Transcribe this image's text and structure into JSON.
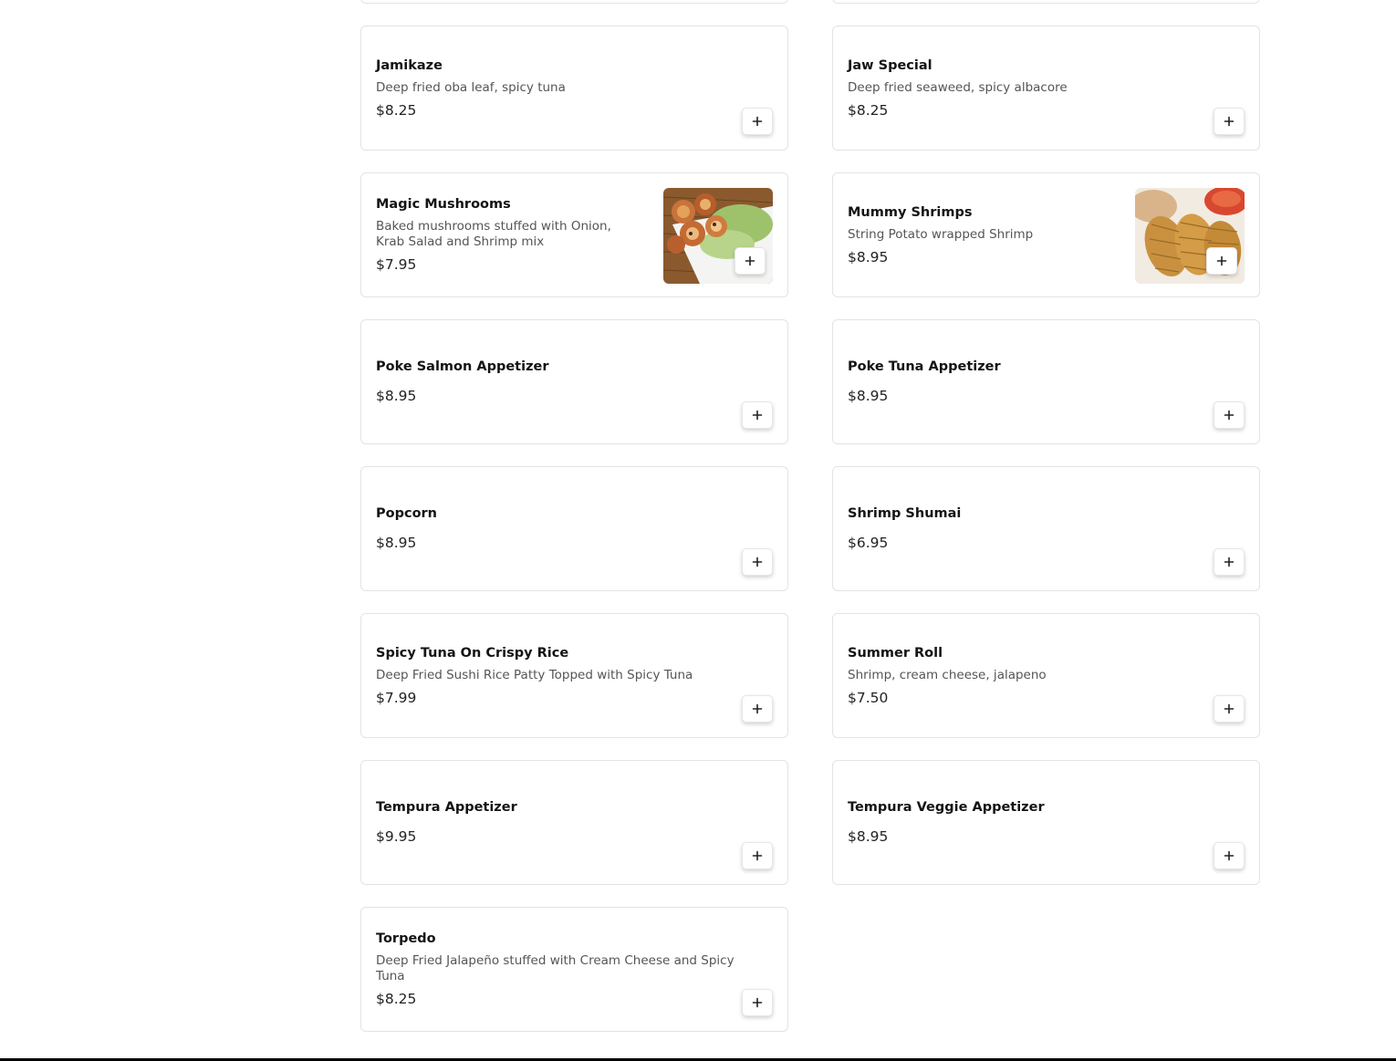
{
  "items": [
    {
      "name": "Jamikaze",
      "desc": "Deep fried oba leaf, spicy tuna",
      "price": "$8.25"
    },
    {
      "name": "Jaw Special",
      "desc": "Deep fried seaweed, spicy albacore",
      "price": "$8.25"
    },
    {
      "name": "Magic Mushrooms",
      "desc": "Baked mushrooms stuffed with Onion, Krab Salad and Shrimp mix",
      "price": "$7.95"
    },
    {
      "name": "Mummy Shrimps",
      "desc": "String Potato wrapped Shrimp",
      "price": "$8.95"
    },
    {
      "name": "Poke Salmon Appetizer",
      "desc": "",
      "price": "$8.95"
    },
    {
      "name": "Poke Tuna Appetizer",
      "desc": "",
      "price": "$8.95"
    },
    {
      "name": "Popcorn",
      "desc": "",
      "price": "$8.95"
    },
    {
      "name": "Shrimp Shumai",
      "desc": "",
      "price": "$6.95"
    },
    {
      "name": "Spicy Tuna On Crispy Rice",
      "desc": "Deep Fried Sushi Rice Patty Topped with Spicy Tuna",
      "price": "$7.99"
    },
    {
      "name": "Summer Roll",
      "desc": "Shrimp, cream cheese, jalapeno",
      "price": "$7.50"
    },
    {
      "name": "Tempura Appetizer",
      "desc": "",
      "price": "$9.95"
    },
    {
      "name": "Tempura Veggie Appetizer",
      "desc": "",
      "price": "$8.95"
    },
    {
      "name": "Torpedo",
      "desc": "Deep Fried Jalapeño stuffed with Cream Cheese and Spicy Tuna",
      "price": "$8.25"
    }
  ],
  "icons": {
    "add": "plus-icon"
  },
  "colors": {
    "border": "#e3e3e3",
    "text": "#141414",
    "muted": "#555555"
  }
}
